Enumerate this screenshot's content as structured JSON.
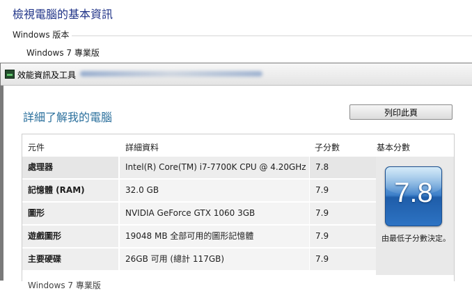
{
  "system": {
    "title": "檢視電腦的基本資訊",
    "section_label": "Windows 版本",
    "edition": "Windows 7 專業版"
  },
  "window": {
    "title": "效能資訊及工具",
    "heading": "詳細了解我的電腦",
    "print_button": "列印此頁"
  },
  "table": {
    "headers": {
      "component": "元件",
      "details": "詳細資料",
      "subscore": "子分數",
      "basescore": "基本分數"
    },
    "rows": [
      {
        "component": "處理器",
        "details": "Intel(R) Core(TM) i7-7700K CPU @ 4.20GHz",
        "subscore": "7.8"
      },
      {
        "component": "記憶體 (RAM)",
        "details": "32.0 GB",
        "subscore": "7.9"
      },
      {
        "component": "圖形",
        "details": "NVIDIA GeForce GTX 1060 3GB",
        "subscore": "7.9"
      },
      {
        "component": "遊戲圖形",
        "details": "19048 MB 全部可用的圖形記憶體",
        "subscore": "7.9"
      },
      {
        "component": "主要硬碟",
        "details": "26GB 可用 (總計 117GB)",
        "subscore": "7.9"
      }
    ],
    "base_score": "7.8",
    "base_note": "由最低子分數決定。",
    "footer_partial": "Windows 7 專業版"
  },
  "colors": {
    "title_blue": "#1e3287",
    "heading_blue": "#2a6f9c",
    "score_tile_blue": "#2d73c3"
  }
}
